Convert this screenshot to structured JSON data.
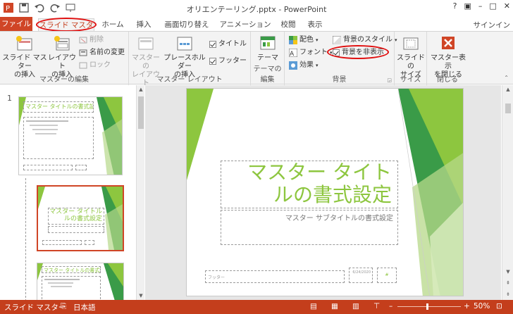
{
  "window": {
    "title": "オリエンテーリング.pptx - PowerPoint",
    "help": "?",
    "minimize": "–",
    "maximize": "□",
    "close": "✕"
  },
  "tabs": {
    "file": "ファイル",
    "slide_master": "スライド マスター",
    "home": "ホーム",
    "insert": "挿入",
    "transitions": "画面切り替え",
    "animations": "アニメーション",
    "review": "校閲",
    "view": "表示",
    "signin": "サインイン"
  },
  "ribbon": {
    "edit_master": {
      "insert_master": "スライド マスター\nの挿入",
      "insert_layout": "レイアウト\nの挿入",
      "delete": "削除",
      "rename": "名前の変更",
      "lock": "ロック",
      "label": "マスターの編集"
    },
    "master_layout": {
      "master_layout": "マスターの\nレイアウト",
      "insert_placeholder": "プレースホルダー\nの挿入",
      "title": "タイトル",
      "footer": "フッター",
      "label": "マスター レイアウト"
    },
    "edit_theme": {
      "themes": "テーマ",
      "label": "テーマの編集"
    },
    "background": {
      "colors": "配色",
      "fonts": "フォント",
      "effects": "効果",
      "bg_styles": "背景のスタイル",
      "hide_bg": "背景を非表示",
      "label": "背景"
    },
    "size": {
      "slide_size": "スライドの\nサイズ",
      "label": "サイズ"
    },
    "close": {
      "close_master": "マスター表示\nを閉じる",
      "label": "閉じる"
    }
  },
  "thumbnails": {
    "slide_number": "1",
    "thumb1_title": "マスター タイトルの書式設定",
    "thumb2_title": "マスター タイトル\nルの書式設定",
    "thumb3_title": "マスター タイトルの書式設定"
  },
  "slide": {
    "title_line1": "マスター タイト",
    "title_line2": "ルの書式設定",
    "subtitle": "マスター サブタイトルの書式設定",
    "footer": "フッター",
    "date": "6/24/2020",
    "page": "#"
  },
  "status": {
    "mode": "スライド マスター",
    "language": "日本語",
    "zoom": "50%"
  },
  "colors": {
    "accent": "#c43e1c",
    "green": "#8dc63f",
    "highlight": "#e01010"
  }
}
